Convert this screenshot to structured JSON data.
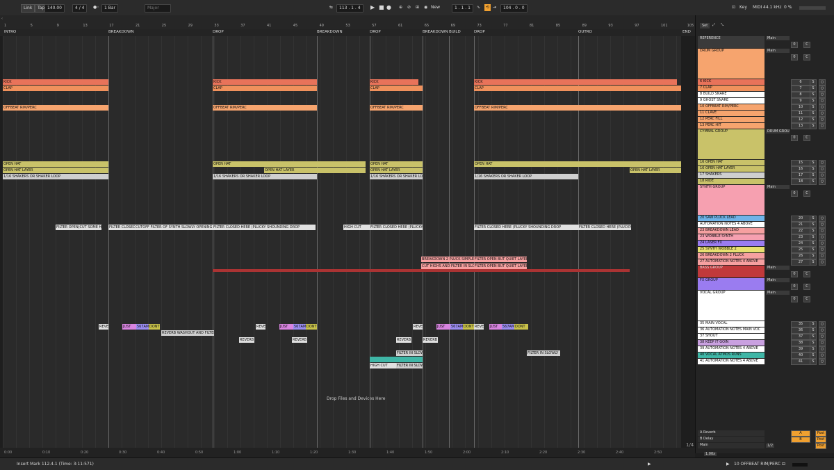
{
  "transport": {
    "link": "Link",
    "tap": "Tap",
    "tempo": "140.00",
    "signature": "4 / 4",
    "quant": "1 Bar",
    "key_scale": "Major",
    "position": "113 . 1 . 4",
    "new": "New",
    "loop_start": "1 . 1 . 1",
    "loop_length": "104 . 0 . 0",
    "key": "Key",
    "midi": "MIDI",
    "sample_rate": "44.1 kHz",
    "cpu": "0 %"
  },
  "ruler": [
    "1",
    "5",
    "9",
    "13",
    "17",
    "21",
    "25",
    "29",
    "33",
    "37",
    "41",
    "45",
    "49",
    "53",
    "57",
    "61",
    "65",
    "69",
    "73",
    "77",
    "81",
    "85",
    "89",
    "93",
    "97",
    "101",
    "105"
  ],
  "locators": [
    "INTRO",
    "BREAKDOWN",
    "DROP",
    "BREAKDOWN",
    "DROP",
    "BREAKDOWN",
    "BUILD",
    "DROP",
    "OUTRO",
    "END"
  ],
  "time_ticks": [
    "0:00",
    "0:10",
    "0:20",
    "0:30",
    "0:40",
    "0:50",
    "1:00",
    "1:10",
    "1:20",
    "1:30",
    "1:40",
    "1:50",
    "2:00",
    "2:10",
    "2:20",
    "2:30",
    "2:40",
    "2:50"
  ],
  "arrangement": {
    "drop_hint": "Drop Files and Devices Here",
    "clips": [
      {
        "t": "KICK",
        "c": "#e8735a"
      },
      {
        "t": "CLAP",
        "c": "#f0915c"
      },
      {
        "t": "OFFBEAT RIM/PERC",
        "c": "#f6a46e"
      },
      {
        "t": "OPEN HAT",
        "c": "#c9c269"
      },
      {
        "t": "OPEN HAT LAYER",
        "c": "#c9c269"
      },
      {
        "t": "1/16 SHAKERS OR SHAKER LOOP",
        "c": "#cfcfcf"
      },
      {
        "t": "FILTER OPEN(CUT SOME HI)",
        "c": "#e0e0e0"
      },
      {
        "t": "FILTER CLOSED",
        "c": "#e0e0e0"
      },
      {
        "t": "CUTOFF FILTER OF SYNTH SLOWLY OPENING",
        "c": "#e0e0e0"
      },
      {
        "t": "FILTER CLOSED HERE (PLUCKY SHOUNDING DROP",
        "c": "#e0e0e0"
      },
      {
        "t": "HIGH CUT",
        "c": "#e0e0e0"
      },
      {
        "t": "BREAKDOWN 2 PLUCK SIMPLE",
        "c": "#f6a0a0"
      },
      {
        "t": "CUT HIGHS AND FILTER IN SLOWLY",
        "c": "#f6a0a0"
      },
      {
        "t": "FILTER OPEN BUT QUIET LAYER",
        "c": "#f6a0a0"
      },
      {
        "t": "REVERB WASHOUT AND FILTER",
        "c": "#cfcfcf"
      },
      {
        "t": "REVERB",
        "c": "#e0e0e0"
      },
      {
        "t": "FILTER IN SLOWLY",
        "c": "#cfcfcf"
      },
      {
        "t": "JUST",
        "c": "#d884e0"
      },
      {
        "t": "567AM",
        "c": "#9a8cf0"
      },
      {
        "t": "DONT",
        "c": "#c9c24a"
      }
    ]
  },
  "tracks": [
    {
      "name": "REFERENCE",
      "n": "",
      "c": "#3a3a3a",
      "out": "Main"
    },
    {
      "name": "DRUM GROUP",
      "n": "",
      "c": "#f6a46e",
      "out": "Main"
    },
    {
      "name": "6 KICK",
      "n": "6",
      "c": "#e8735a"
    },
    {
      "name": "7 CLAP",
      "n": "7",
      "c": "#f0915c"
    },
    {
      "name": "8 BUILD SNARE",
      "n": "8",
      "c": "#ffffff"
    },
    {
      "name": "9 GHOST SNARE",
      "n": "9",
      "c": "#ffffff"
    },
    {
      "name": "10 OFFBEAT RIM/PERC",
      "n": "10",
      "c": "#f6a46e"
    },
    {
      "name": "11 CLAVE",
      "n": "11",
      "c": "#f6a46e"
    },
    {
      "name": "12 PERC FILL",
      "n": "12",
      "c": "#f6a46e"
    },
    {
      "name": "13 PERC HIT",
      "n": "13",
      "c": "#f6a46e"
    },
    {
      "name": "CYMBAL GROUP",
      "n": "",
      "c": "#c9c269",
      "out": "DRUM GROU"
    },
    {
      "name": "16 OPEN HAT",
      "n": "15",
      "c": "#c9c269"
    },
    {
      "name": "16 OPEN HAT LAYER",
      "n": "16",
      "c": "#c9c269"
    },
    {
      "name": "17 SHAKERS",
      "n": "17",
      "c": "#cfcfcf"
    },
    {
      "name": "18 RIDE",
      "n": "18",
      "c": "#c9c269"
    },
    {
      "name": "SYNTH GROUP",
      "n": "",
      "c": "#f6a0b0",
      "out": "Main"
    },
    {
      "name": "20 SAW PLUCK LEAD",
      "n": "20",
      "c": "#6fb3e8"
    },
    {
      "name": "AUTOMATION NOTES 4 ABOVE",
      "n": "21",
      "c": "#ffffff"
    },
    {
      "name": "23 BREAKDOWN LEAD",
      "n": "22",
      "c": "#f6a0a0"
    },
    {
      "name": "23 WOBBLE SYNTH",
      "n": "23",
      "c": "#f6a0b0"
    },
    {
      "name": "24 LASER FX",
      "n": "24",
      "c": "#9a7cf0"
    },
    {
      "name": "25 SYNTH WOBBLE 2",
      "n": "25",
      "c": "#e8e070"
    },
    {
      "name": "26 BREAKDOWN 2 PLUCK",
      "n": "26",
      "c": "#f6a0a0"
    },
    {
      "name": "27 AUTOMATION NOTES 4 ABOVE",
      "n": "27",
      "c": "#f6a0a0"
    },
    {
      "name": "BASS GROUP",
      "n": "",
      "c": "#c0393b",
      "out": "Main"
    },
    {
      "name": "FX GROUP",
      "n": "",
      "c": "#9a7cf0",
      "out": "Main"
    },
    {
      "name": "VOCAL GROUP",
      "n": "",
      "c": "#ffffff",
      "out": "Main"
    },
    {
      "name": "35 MAIN VOCAL",
      "n": "35",
      "c": "#ffffff"
    },
    {
      "name": "36 AUTOMATION NOTES MAIN VOC",
      "n": "36",
      "c": "#ffffff"
    },
    {
      "name": "37 SHOUT",
      "n": "37",
      "c": "#ffffff"
    },
    {
      "name": "38 KEEP IT GOIN",
      "n": "38",
      "c": "#c9a0e0"
    },
    {
      "name": "39 AUTOMATION NOTES 4 ABOVE",
      "n": "39",
      "c": "#ffffff"
    },
    {
      "name": "40 VOCAL ATMOS RUNS",
      "n": "40",
      "c": "#3fb6a6"
    },
    {
      "name": "41 AUTOMATION NOTES 4 ABOVE",
      "n": "41",
      "c": "#ffffff"
    }
  ],
  "returns": [
    {
      "name": "A Reverb",
      "letter": "A",
      "post": "Post"
    },
    {
      "name": "B Delay",
      "letter": "B",
      "post": "Post"
    },
    {
      "name": "Main",
      "letter": "",
      "post": "Post"
    }
  ],
  "mixer": {
    "set": "Set",
    "ratio": "1/2",
    "zoom": "1.00x",
    "page": "1/4"
  },
  "status": {
    "left": "Insert Mark 112.4.1 (Time: 3:11:571)",
    "right": "10 OFFBEAT RIM/PERC"
  }
}
